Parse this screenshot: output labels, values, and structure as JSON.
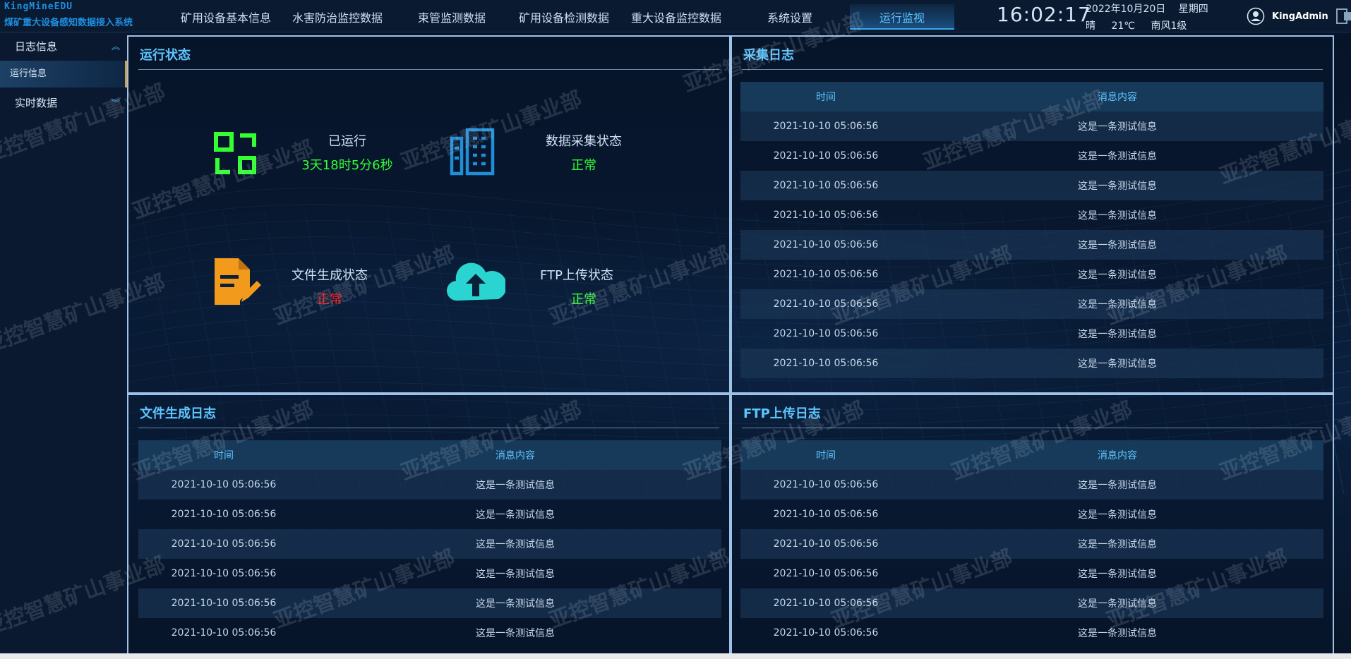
{
  "header": {
    "logo_en": "KingMineEDU",
    "logo_cn": "煤矿重大设备感知数据接入系统",
    "nav": [
      "矿用设备基本信息",
      "水害防治监控数据",
      "束管监测数据",
      "矿用设备检测数据",
      "重大设备监控数据",
      "系统设置",
      "运行监视"
    ],
    "active_nav": "运行监视",
    "time": "16:02:17",
    "date": "2022年10月20日",
    "weekday": "星期四",
    "weather": "晴",
    "temperature": "21℃",
    "wind": "南风1级",
    "username": "KingAdmin"
  },
  "sidebar": {
    "groups": [
      {
        "label": "日志信息",
        "expanded": true,
        "items": [
          {
            "label": "运行信息",
            "active": true
          }
        ]
      },
      {
        "label": "实时数据",
        "expanded": false,
        "items": []
      }
    ]
  },
  "status_panel": {
    "title": "运行状态",
    "items": [
      {
        "label": "已运行",
        "value": "3天18时5分6秒",
        "value_color": "#33ff33",
        "icon": "uptime-icon"
      },
      {
        "label": "数据采集状态",
        "value": "正常",
        "value_color": "#33ff33",
        "icon": "building-icon"
      },
      {
        "label": "文件生成状态",
        "value": "正常",
        "value_color": "#ff1a1a",
        "icon": "file-edit-icon"
      },
      {
        "label": "FTP上传状态",
        "value": "正常",
        "value_color": "#33ff33",
        "icon": "cloud-upload-icon"
      }
    ]
  },
  "collect_log": {
    "title": "采集日志",
    "columns": [
      "时间",
      "消息内容"
    ],
    "rows": [
      [
        "2021-10-10 05:06:56",
        "这是一条测试信息"
      ],
      [
        "2021-10-10 05:06:56",
        "这是一条测试信息"
      ],
      [
        "2021-10-10 05:06:56",
        "这是一条测试信息"
      ],
      [
        "2021-10-10 05:06:56",
        "这是一条测试信息"
      ],
      [
        "2021-10-10 05:06:56",
        "这是一条测试信息"
      ],
      [
        "2021-10-10 05:06:56",
        "这是一条测试信息"
      ],
      [
        "2021-10-10 05:06:56",
        "这是一条测试信息"
      ],
      [
        "2021-10-10 05:06:56",
        "这是一条测试信息"
      ],
      [
        "2021-10-10 05:06:56",
        "这是一条测试信息"
      ]
    ]
  },
  "file_log": {
    "title": "文件生成日志",
    "columns": [
      "时间",
      "消息内容"
    ],
    "rows": [
      [
        "2021-10-10 05:06:56",
        "这是一条测试信息"
      ],
      [
        "2021-10-10 05:06:56",
        "这是一条测试信息"
      ],
      [
        "2021-10-10 05:06:56",
        "这是一条测试信息"
      ],
      [
        "2021-10-10 05:06:56",
        "这是一条测试信息"
      ],
      [
        "2021-10-10 05:06:56",
        "这是一条测试信息"
      ],
      [
        "2021-10-10 05:06:56",
        "这是一条测试信息"
      ]
    ]
  },
  "ftp_log": {
    "title": "FTP上传日志",
    "columns": [
      "时间",
      "消息内容"
    ],
    "rows": [
      [
        "2021-10-10 05:06:56",
        "这是一条测试信息"
      ],
      [
        "2021-10-10 05:06:56",
        "这是一条测试信息"
      ],
      [
        "2021-10-10 05:06:56",
        "这是一条测试信息"
      ],
      [
        "2021-10-10 05:06:56",
        "这是一条测试信息"
      ],
      [
        "2021-10-10 05:06:56",
        "这是一条测试信息"
      ],
      [
        "2021-10-10 05:06:56",
        "这是一条测试信息"
      ]
    ]
  },
  "watermark": "亚控智慧矿山事业部",
  "colors": {
    "accent": "#5ec6ff",
    "ok": "#33ff33",
    "error": "#ff1a1a",
    "panel_border": "#9fc1e6"
  }
}
